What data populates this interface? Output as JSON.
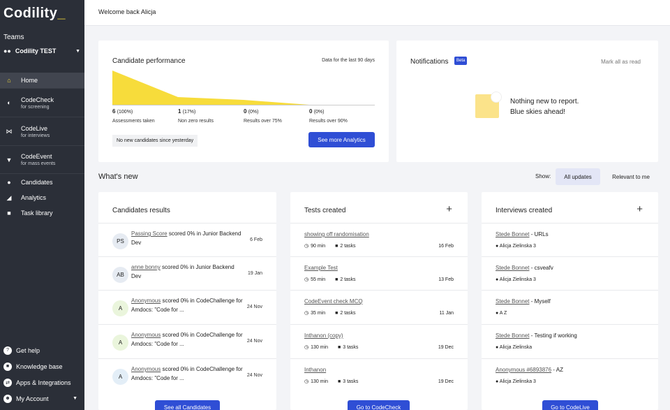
{
  "sidebar": {
    "logo": "Codility",
    "teams_label": "Teams",
    "team_name": "Codility TEST",
    "nav": [
      {
        "label": "Home",
        "icon": "home-icon"
      },
      {
        "label": "CodeCheck",
        "sub": "for screening",
        "icon": "codecheck-icon"
      },
      {
        "label": "CodeLive",
        "sub": "for interviews",
        "icon": "codelive-icon"
      },
      {
        "label": "CodeEvent",
        "sub": "for mass events",
        "icon": "trophy-icon"
      },
      {
        "label": "Candidates",
        "icon": "users-icon"
      },
      {
        "label": "Analytics",
        "icon": "chart-icon"
      },
      {
        "label": "Task library",
        "icon": "book-icon"
      }
    ],
    "bottom": [
      {
        "label": "Get help",
        "icon": "help-icon"
      },
      {
        "label": "Knowledge base",
        "icon": "book-icon"
      },
      {
        "label": "Apps & Integrations",
        "icon": "plug-icon"
      },
      {
        "label": "My Account",
        "icon": "account-icon"
      }
    ]
  },
  "topbar": {
    "welcome": "Welcome back Alicja"
  },
  "performance": {
    "title": "Candidate performance",
    "range": "Data for the last 90 days",
    "stats": [
      {
        "value": "6",
        "pct": "(100%)",
        "label": "Assessments taken"
      },
      {
        "value": "1",
        "pct": "(17%)",
        "label": "Non zero results"
      },
      {
        "value": "0",
        "pct": "(0%)",
        "label": "Results over 75%"
      },
      {
        "value": "0",
        "pct": "(0%)",
        "label": "Results over 90%"
      }
    ],
    "note": "No new candidates since yesterday",
    "button": "See more Analytics",
    "accent": "#f7dc3b"
  },
  "notifications": {
    "title": "Notifications",
    "badge": "Beta",
    "mark_read": "Mark all as read",
    "empty_line1": "Nothing new to report.",
    "empty_line2": "Blue skies ahead!"
  },
  "whats_new": {
    "title": "What's new",
    "show_label": "Show:",
    "tab_all": "All updates",
    "tab_relevant": "Relevant to me"
  },
  "candidates": {
    "title": "Candidates results",
    "rows": [
      {
        "initials": "PS",
        "name": "Passing Score",
        "rest": " scored 0% in Junior Backend Dev",
        "date": "6 Feb",
        "color": "#e6ebf2"
      },
      {
        "initials": "AB",
        "name": "anne bonny",
        "rest": " scored 0% in Junior Backend Dev",
        "date": "19 Jan",
        "color": "#e6ebf2"
      },
      {
        "initials": "A",
        "name": "Anonymous",
        "rest": " scored 0% in CodeChallenge for Amdocs: \"Code for ...",
        "date": "24 Nov",
        "color": "#eaf5dc"
      },
      {
        "initials": "A",
        "name": "Anonymous",
        "rest": " scored 0% in CodeChallenge for Amdocs: \"Code for ...",
        "date": "24 Nov",
        "color": "#eaf5dc"
      },
      {
        "initials": "A",
        "name": "Anonymous",
        "rest": " scored 0% in CodeChallenge for Amdocs: \"Code for ...",
        "date": "24 Nov",
        "color": "#e3eef7"
      }
    ],
    "button": "See all Candidates"
  },
  "tests": {
    "title": "Tests created",
    "rows": [
      {
        "name": "showing off randomisation",
        "time": "90 min",
        "tasks": "2 tasks",
        "date": "16 Feb"
      },
      {
        "name": "Example Test",
        "time": "55 min",
        "tasks": "2 tasks",
        "date": "13 Feb"
      },
      {
        "name": "CodeEvent check MCQ",
        "time": "35 min",
        "tasks": "2 tasks",
        "date": "11 Jan"
      },
      {
        "name": "Inthanon (copy)",
        "time": "130 min",
        "tasks": "3 tasks",
        "date": "19 Dec"
      },
      {
        "name": "Inthanon",
        "time": "130 min",
        "tasks": "3 tasks",
        "date": "19 Dec"
      }
    ],
    "button": "Go to CodeCheck"
  },
  "interviews": {
    "title": "Interviews created",
    "rows": [
      {
        "name": "Stede Bonnet",
        "rest": " - URLs",
        "people": "Alicja Zielinska 3"
      },
      {
        "name": "Stede Bonnet",
        "rest": " - csveafv",
        "people": "Alicja Zielinska 3"
      },
      {
        "name": "Stede Bonnet",
        "rest": " - Myself",
        "people": "A Z"
      },
      {
        "name": "Stede Bonnet",
        "rest": " - Testing if working",
        "people": "Alicja Zielinska"
      },
      {
        "name": "Anonymous #6893876",
        "rest": " - AZ",
        "people": "Alicja Zielinska 3"
      }
    ],
    "button": "Go to CodeLive"
  }
}
